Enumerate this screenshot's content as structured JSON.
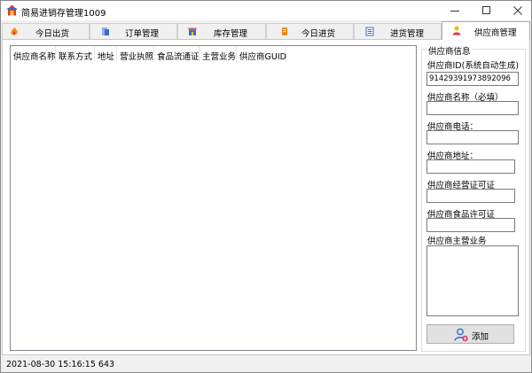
{
  "window": {
    "title": "简易进销存管理1009"
  },
  "tabs": [
    {
      "label": "今日出货",
      "icon": "fire-icon"
    },
    {
      "label": "订单管理",
      "icon": "order-icon"
    },
    {
      "label": "库存管理",
      "icon": "warehouse-icon"
    },
    {
      "label": "今日进货",
      "icon": "incoming-icon"
    },
    {
      "label": "进货管理",
      "icon": "purchase-icon"
    },
    {
      "label": "供应商管理",
      "icon": "supplier-icon",
      "active": true
    }
  ],
  "table": {
    "columns": [
      "供应商名称",
      "联系方式",
      "地址",
      "营业执照",
      "食品流通证",
      "主营业务",
      "供应商GUID"
    ],
    "rows": []
  },
  "supplier_form": {
    "legend": "供应商信息",
    "id_label": "供应商ID(系统自动生成)",
    "id_value": "91429391973892096",
    "name_label": "供应商名称（必填）",
    "name_value": "",
    "phone_label": "供应商电话：",
    "phone_value": "",
    "address_label": "供应商地址：",
    "address_value": "",
    "business_license_label": "供应商经营证可证",
    "business_license_value": "",
    "food_license_label": "供应商食品许可证",
    "food_license_value": "",
    "main_business_label": "供应商主营业务",
    "main_business_value": "",
    "add_button_label": "添加"
  },
  "status_bar": {
    "text": "2021-08-30 15:16:15 643"
  },
  "colors": {
    "accent": "#2f6fd6",
    "fire": "#f08a1c",
    "border": "#828790"
  }
}
